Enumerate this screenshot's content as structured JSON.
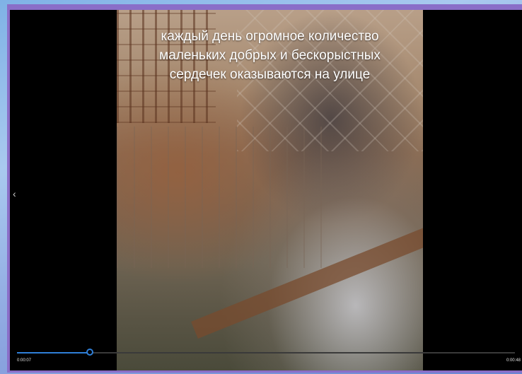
{
  "player": {
    "caption_lines": [
      "каждый день огромное количество",
      "маленьких добрых и бескорыстных",
      "сердечек оказываются на улице"
    ],
    "current_time": "0:00:07",
    "total_time": "0:00:48",
    "progress": 0.146,
    "accent_color": "#2f7fd8",
    "prev_icon": "chevron-left-icon"
  }
}
